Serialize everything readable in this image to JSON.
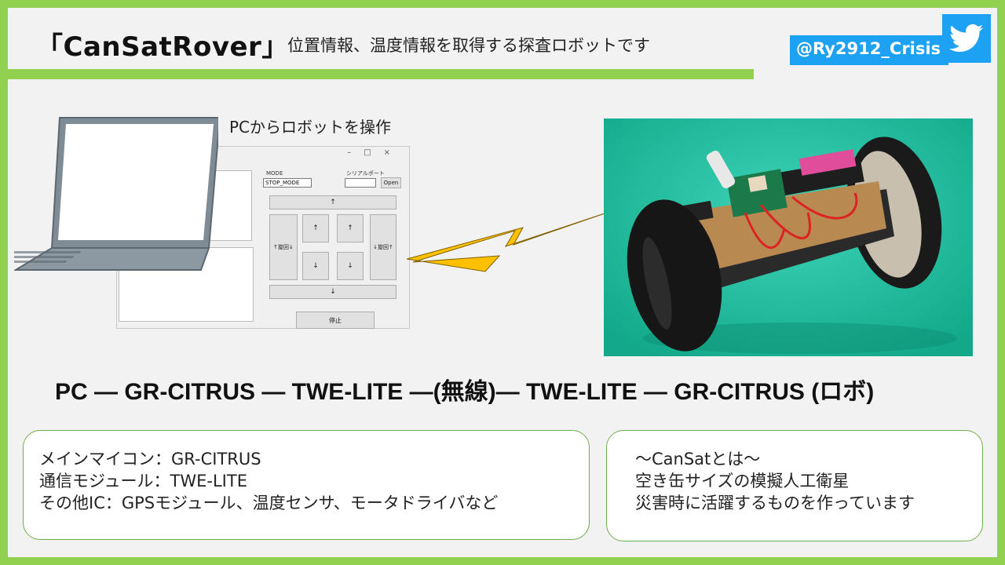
{
  "header": {
    "title": "「CanSatRover」",
    "subtitle": "位置情報、温度情報を取得する探査ロボットです",
    "twitter_handle": "@Ry2912_Crisis"
  },
  "illustration": {
    "caption": "PCからロボットを操作",
    "app": {
      "mode_label": "MODE",
      "mode_value": "STOP_MODE",
      "serial_label": "シリアルポート",
      "open_button": "Open",
      "forward_button": "↑",
      "backward_button": "↓",
      "left_turn_button": "↑旋回↓",
      "right_turn_button": "↓旋回↑",
      "left_up_button": "↑",
      "right_up_button": "↑",
      "left_down_button": "↓",
      "right_down_button": "↓",
      "stop_button": "停止"
    }
  },
  "chain_text": "PC — GR-CITRUS — TWE-LITE —(無線)— TWE-LITE — GR-CITRUS (ロボ)",
  "specs": [
    "メインマイコン：GR-CITRUS",
    "通信モジュール：TWE-LITE",
    "その他IC：GPSモジュール、温度センサ、モータドライバなど"
  ],
  "about": [
    "〜CanSatとは〜",
    "空き缶サイズの模擬人工衛星",
    "災害時に活躍するものを作っています"
  ],
  "colors": {
    "accent_green": "#92d050",
    "twitter_blue": "#1da1f2",
    "bolt_yellow": "#ffc000"
  }
}
